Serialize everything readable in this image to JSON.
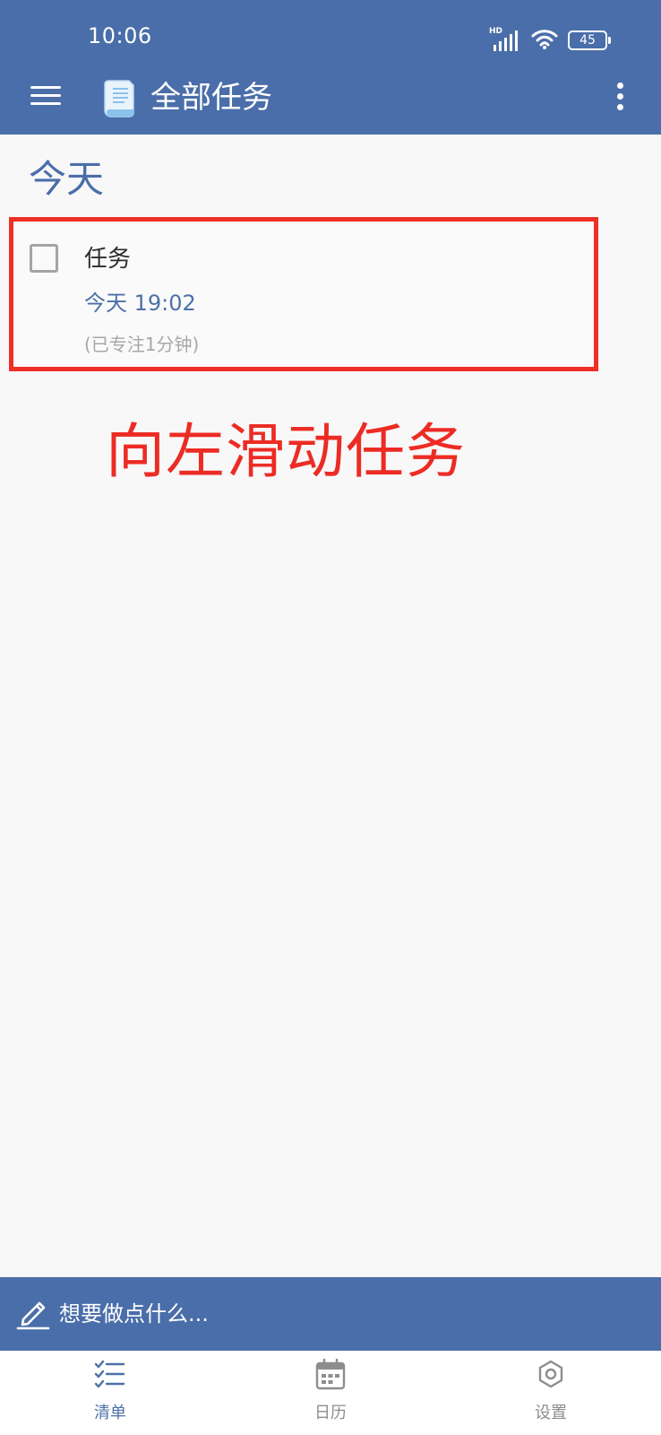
{
  "status_bar": {
    "time": "10:06",
    "network_label": "HD",
    "battery": "45"
  },
  "header": {
    "title": "全部任务"
  },
  "section": {
    "title": "今天"
  },
  "task": {
    "title": "任务",
    "due": "今天 19:02",
    "focus": "(已专注1分钟)"
  },
  "annotation": {
    "instruction": "向左滑动任务"
  },
  "quick_add": {
    "placeholder": "想要做点什么..."
  },
  "nav": {
    "items": [
      {
        "label": "清单",
        "icon": "checklist-icon"
      },
      {
        "label": "日历",
        "icon": "calendar-icon"
      },
      {
        "label": "设置",
        "icon": "settings-icon"
      }
    ]
  },
  "colors": {
    "primary": "#4a6ea9",
    "accent": "#4d71a7",
    "annotation": "#ec2c24",
    "background": "#f8f8f9"
  }
}
